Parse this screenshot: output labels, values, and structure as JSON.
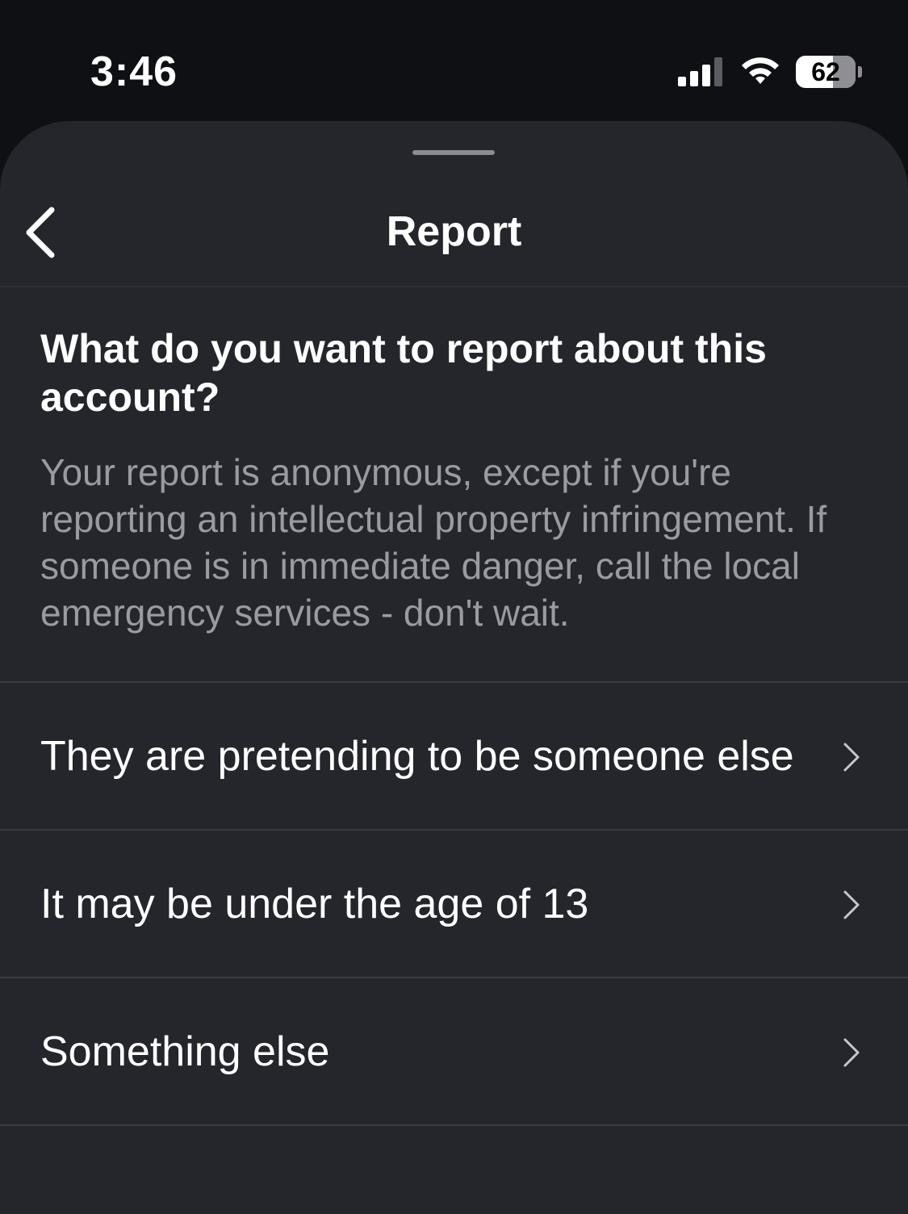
{
  "status_bar": {
    "time": "3:46",
    "battery_level": "62",
    "battery_fraction": 0.62,
    "icons": [
      "cellular-signal-icon",
      "wifi-icon",
      "battery-icon"
    ]
  },
  "nav": {
    "title": "Report",
    "back_icon": "chevron-left-icon"
  },
  "header": {
    "question": "What do you want to report about this account?",
    "description": "Your report is anonymous, except if you're reporting an intellectual property infringement. If someone is in immediate danger, call the local emergency services - don't wait."
  },
  "options": [
    {
      "label": "They are pretending to be someone else",
      "icon": "chevron-right-icon"
    },
    {
      "label": "It may be under the age of 13",
      "icon": "chevron-right-icon"
    },
    {
      "label": "Something else",
      "icon": "chevron-right-icon"
    }
  ],
  "colors": {
    "background": "#0f1013",
    "sheet": "#25262b",
    "divider": "#3a3b41",
    "secondary_text": "#9a9ba1",
    "primary_text": "#ffffff"
  }
}
